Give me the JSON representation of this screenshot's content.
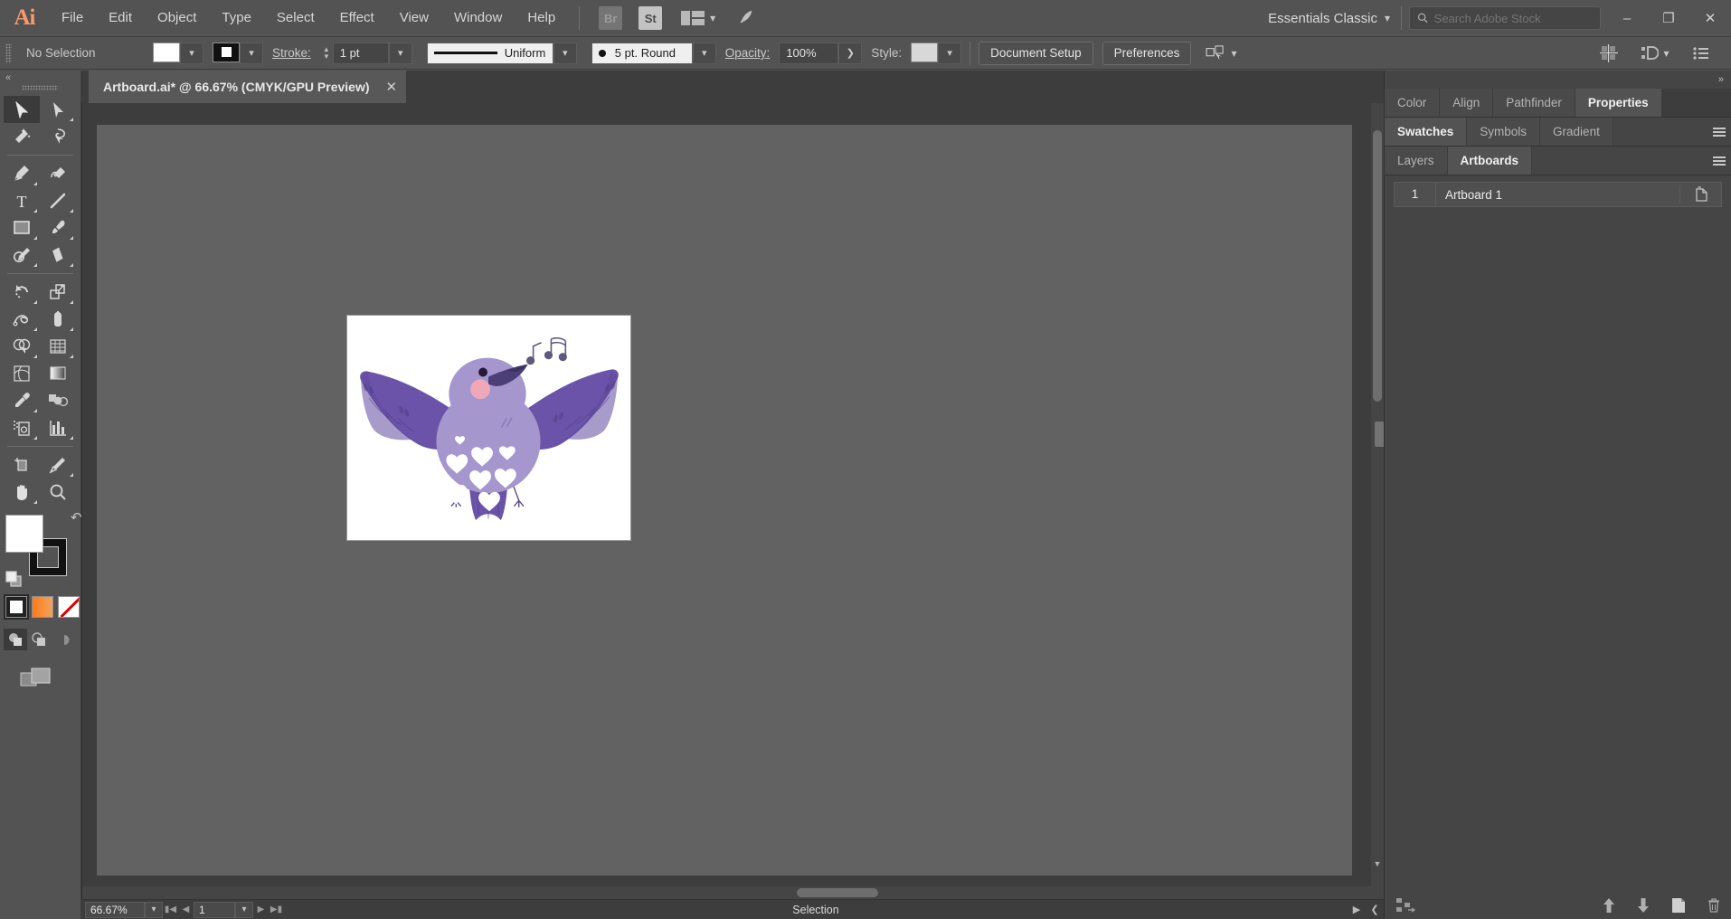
{
  "app": {
    "name": "Adobe Illustrator",
    "logo_text": "Ai",
    "accent_color": "#f79a6a",
    "chrome_bg": "#535353"
  },
  "menubar": {
    "items": [
      {
        "label": "File"
      },
      {
        "label": "Edit"
      },
      {
        "label": "Object"
      },
      {
        "label": "Type"
      },
      {
        "label": "Select"
      },
      {
        "label": "Effect"
      },
      {
        "label": "View"
      },
      {
        "label": "Window"
      },
      {
        "label": "Help"
      }
    ],
    "bridge_label": "Br",
    "stock_label": "St",
    "arrange_icon": "arrange-documents-icon",
    "rocket_icon": "discover-rocket-icon",
    "workspace": "Essentials Classic",
    "search_placeholder": "Search Adobe Stock",
    "search_value": "",
    "window_controls": {
      "minimize": "–",
      "restore": "❐",
      "close": "✕"
    }
  },
  "controlbar": {
    "selection_label": "No Selection",
    "fill_swatch_color": "#ffffff",
    "stroke_swatch_color": "#000000",
    "stroke_label": "Stroke:",
    "stroke_weight": "1 pt",
    "stroke_profile": "Uniform",
    "brush_definition": "5 pt. Round",
    "opacity_label": "Opacity:",
    "opacity_value": "100%",
    "style_label": "Style:",
    "style_swatch_color": "#d8d8d8",
    "document_setup_label": "Document Setup",
    "preferences_label": "Preferences",
    "select_similar_icon": "select-similar-objects-icon",
    "align_icon": "align-grid-icon",
    "distribute_icon": "distribute-objects-icon",
    "options_icon": "more-options-icon"
  },
  "toolbar": {
    "tools": [
      {
        "name": "selection-tool",
        "active": true,
        "flyout": false
      },
      {
        "name": "direct-selection-tool",
        "active": false,
        "flyout": true
      },
      {
        "name": "magic-wand-tool",
        "active": false,
        "flyout": false
      },
      {
        "name": "lasso-tool",
        "active": false,
        "flyout": false
      },
      {
        "name": "pen-tool",
        "active": false,
        "flyout": true
      },
      {
        "name": "curvature-tool",
        "active": false,
        "flyout": false
      },
      {
        "name": "type-tool",
        "active": false,
        "flyout": true
      },
      {
        "name": "line-segment-tool",
        "active": false,
        "flyout": true
      },
      {
        "name": "rectangle-tool",
        "active": false,
        "flyout": true
      },
      {
        "name": "paintbrush-tool",
        "active": false,
        "flyout": true
      },
      {
        "name": "shaper-pencil-tool",
        "active": false,
        "flyout": true
      },
      {
        "name": "eraser-tool",
        "active": false,
        "flyout": true
      },
      {
        "name": "rotate-tool",
        "active": false,
        "flyout": true
      },
      {
        "name": "scale-tool",
        "active": false,
        "flyout": true
      },
      {
        "name": "width-tool",
        "active": false,
        "flyout": true
      },
      {
        "name": "free-transform-tool",
        "active": false,
        "flyout": true
      },
      {
        "name": "shape-builder-tool",
        "active": false,
        "flyout": true
      },
      {
        "name": "perspective-grid-tool",
        "active": false,
        "flyout": true
      },
      {
        "name": "mesh-tool",
        "active": false,
        "flyout": false
      },
      {
        "name": "gradient-tool",
        "active": false,
        "flyout": false
      },
      {
        "name": "eyedropper-tool",
        "active": false,
        "flyout": true
      },
      {
        "name": "blend-tool",
        "active": false,
        "flyout": false
      },
      {
        "name": "symbol-sprayer-tool",
        "active": false,
        "flyout": true
      },
      {
        "name": "column-graph-tool",
        "active": false,
        "flyout": true
      },
      {
        "name": "artboard-tool",
        "active": false,
        "flyout": false
      },
      {
        "name": "slice-tool",
        "active": false,
        "flyout": true
      },
      {
        "name": "hand-tool",
        "active": false,
        "flyout": true
      },
      {
        "name": "zoom-tool",
        "active": false,
        "flyout": false
      }
    ],
    "fill_color": "#ffffff",
    "stroke_color": "#000000",
    "swap_icon": "swap-fill-stroke-icon",
    "default_icon": "default-fill-stroke-icon",
    "color_modes": [
      {
        "name": "color-mode-color",
        "selected": true
      },
      {
        "name": "color-mode-gradient",
        "selected": false
      },
      {
        "name": "color-mode-none",
        "selected": false
      }
    ],
    "draw_modes": [
      {
        "name": "draw-normal-mode",
        "selected": true
      },
      {
        "name": "draw-behind-mode",
        "selected": false
      },
      {
        "name": "draw-inside-mode",
        "selected": false
      }
    ],
    "screen_mode_icon": "change-screen-mode-icon"
  },
  "document": {
    "tab_title": "Artboard.ai* @ 66.67% (CMYK/GPU Preview)",
    "close_icon": "close-tab-icon",
    "artwork": {
      "name": "singing-bird-illustration",
      "colors": {
        "wing_dark": "#6a53a8",
        "body_light": "#a596ce",
        "head": "#a596ce",
        "beak": "#4a3f77",
        "cheek": "#f0a8b8",
        "eye": "#231a33",
        "note": "#5d5a7d",
        "heart": "#ffffff",
        "background": "#ffffff"
      }
    }
  },
  "statusbar": {
    "zoom_value": "66.67%",
    "zoom_dropdown_icon": "chevron-down-icon",
    "first_page_icon": "first-artboard-icon",
    "prev_page_icon": "previous-artboard-icon",
    "page_value": "1",
    "page_dropdown_icon": "chevron-down-icon",
    "next_page_icon": "next-artboard-icon",
    "last_page_icon": "last-artboard-icon",
    "status_text": "Selection",
    "status_menu_icon": "status-menu-icon",
    "resize_icon": "panel-expand-icon"
  },
  "panels": {
    "collapse_icon": "»",
    "group_one": {
      "tabs": [
        {
          "label": "Color",
          "active": false
        },
        {
          "label": "Align",
          "active": false
        },
        {
          "label": "Pathfinder",
          "active": false
        },
        {
          "label": "Properties",
          "active": true
        }
      ]
    },
    "group_two": {
      "tabs": [
        {
          "label": "Swatches",
          "active": true
        },
        {
          "label": "Symbols",
          "active": false
        },
        {
          "label": "Gradient",
          "active": false
        }
      ],
      "menu_icon": "panel-menu-icon"
    },
    "group_three": {
      "tabs": [
        {
          "label": "Layers",
          "active": false
        },
        {
          "label": "Artboards",
          "active": true
        }
      ],
      "menu_icon": "panel-menu-icon"
    },
    "artboards": {
      "rows": [
        {
          "number": "1",
          "name": "Artboard 1"
        }
      ],
      "new_artboard_icon": "new-artboard-icon"
    },
    "footer": {
      "rearrange_icon": "rearrange-artboards-icon",
      "move_up_icon": "move-up-icon",
      "move_down_icon": "move-down-icon",
      "new_icon": "new-artboard-icon",
      "delete_icon": "delete-artboard-icon"
    }
  }
}
